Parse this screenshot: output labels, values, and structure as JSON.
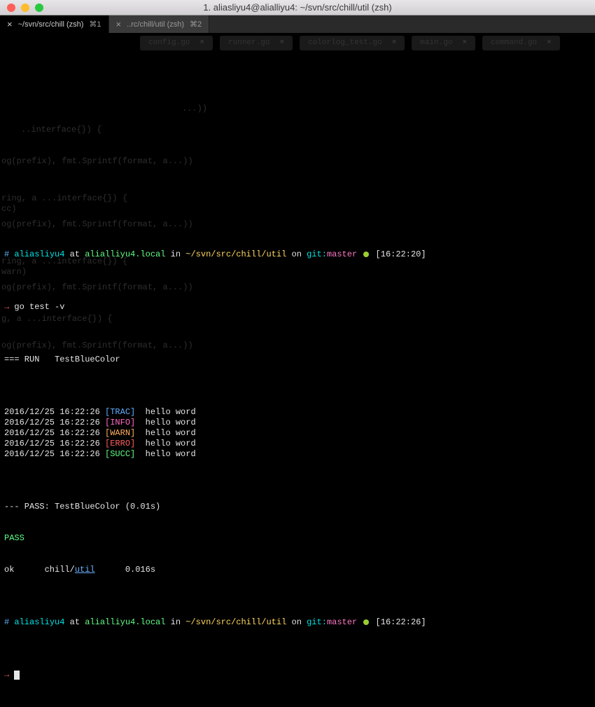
{
  "window": {
    "title": "1. aliasliyu4@alialliyu4: ~/svn/src/chill/util (zsh)"
  },
  "tabs": [
    {
      "label": "~/svn/src/chill (zsh)",
      "shortcut": "⌘1",
      "active": true
    },
    {
      "label": "..rc/chill/util (zsh)",
      "shortcut": "⌘2",
      "active": false
    }
  ],
  "ghost_tabs": [
    {
      "label": "config.go"
    },
    {
      "label": "runner.go"
    },
    {
      "label": "colorlog_test.go"
    },
    {
      "label": "main.go"
    },
    {
      "label": "command.go"
    }
  ],
  "prompt1": {
    "hash": "#",
    "user": "aliasliyu4",
    "at": " at ",
    "host": "alialliyu4.local",
    "in": " in ",
    "path": "~/svn/src/chill/util",
    "on": " on ",
    "git": "git:",
    "branch": "master",
    "time": "[16:22:20]"
  },
  "command": {
    "arrow": "→",
    "text": "go test -v"
  },
  "run_line": "=== RUN   TestBlueColor",
  "logs": [
    {
      "ts": "2016/12/25 16:22:26",
      "tag": "[TRAC]",
      "tagColor": "c-blue",
      "msg": " hello word"
    },
    {
      "ts": "2016/12/25 16:22:26",
      "tag": "[INFO]",
      "tagColor": "c-magenta",
      "msg": " hello word"
    },
    {
      "ts": "2016/12/25 16:22:26",
      "tag": "[WARN]",
      "tagColor": "c-orange",
      "msg": " hello word"
    },
    {
      "ts": "2016/12/25 16:22:26",
      "tag": "[ERRO]",
      "tagColor": "c-red",
      "msg": " hello word"
    },
    {
      "ts": "2016/12/25 16:22:26",
      "tag": "[SUCC]",
      "tagColor": "c-green",
      "msg": " hello word"
    }
  ],
  "pass_line": "--- PASS: TestBlueColor (0.01s)",
  "pass_word": "PASS",
  "ok_line": {
    "ok": "ok  \t",
    "pkg_prefix": "chill/",
    "pkg_link": "util",
    "duration": "\t0.016s"
  },
  "prompt2": {
    "hash": "#",
    "user": "aliasliyu4",
    "at": " at ",
    "host": "alialliyu4.local",
    "in": " in ",
    "path": "~/svn/src/chill/util",
    "on": " on ",
    "git": "git:",
    "branch": "master",
    "time": "[16:22:26]"
  },
  "arrow2": "→",
  "ghost_code": {
    "l1": "..interface{}) {",
    "l2": "og(prefix), fmt.Sprintf(format, a...))",
    "l3": "ring, a ...interface{}) {",
    "l4": "cc)",
    "l5": "og(prefix), fmt.Sprintf(format, a...))",
    "l6": "ring, a ...interface{}) {",
    "l7": "warn)",
    "l8": "og(prefix), fmt.Sprintf(format, a...))",
    "l9": "g, a ...interface{}) {",
    "l10": "og(prefix), fmt.Sprintf(format, a...))",
    "paren": "...))"
  }
}
